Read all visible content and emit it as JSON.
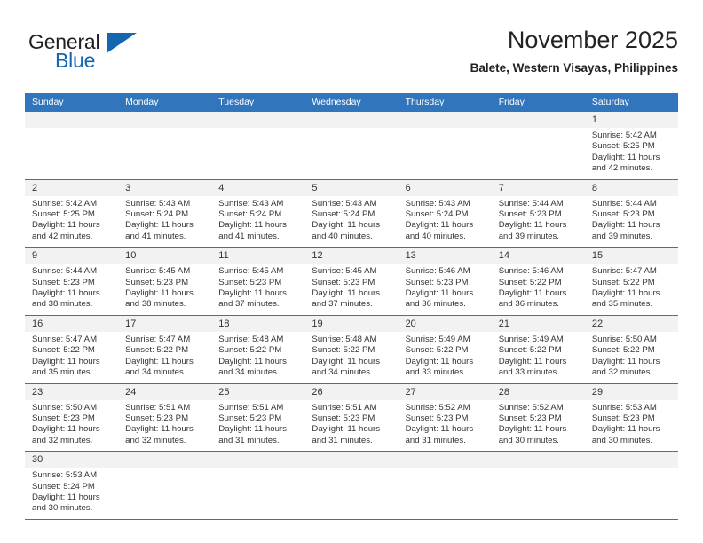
{
  "brand": {
    "name_part1": "General",
    "name_part2": "Blue",
    "triangle_color": "#1466b0"
  },
  "header": {
    "title": "November 2025",
    "subtitle": "Balete, Western Visayas, Philippines"
  },
  "theme": {
    "header_blue": "#3176bc",
    "row_divider": "#3176bc",
    "daynum_band": "#f2f2f2"
  },
  "calendar": {
    "weekday_headers": [
      "Sunday",
      "Monday",
      "Tuesday",
      "Wednesday",
      "Thursday",
      "Friday",
      "Saturday"
    ],
    "weeks": [
      [
        {
          "day": "",
          "lines": []
        },
        {
          "day": "",
          "lines": []
        },
        {
          "day": "",
          "lines": []
        },
        {
          "day": "",
          "lines": []
        },
        {
          "day": "",
          "lines": []
        },
        {
          "day": "",
          "lines": []
        },
        {
          "day": "1",
          "lines": [
            "Sunrise: 5:42 AM",
            "Sunset: 5:25 PM",
            "Daylight: 11 hours",
            "and 42 minutes."
          ]
        }
      ],
      [
        {
          "day": "2",
          "lines": [
            "Sunrise: 5:42 AM",
            "Sunset: 5:25 PM",
            "Daylight: 11 hours",
            "and 42 minutes."
          ]
        },
        {
          "day": "3",
          "lines": [
            "Sunrise: 5:43 AM",
            "Sunset: 5:24 PM",
            "Daylight: 11 hours",
            "and 41 minutes."
          ]
        },
        {
          "day": "4",
          "lines": [
            "Sunrise: 5:43 AM",
            "Sunset: 5:24 PM",
            "Daylight: 11 hours",
            "and 41 minutes."
          ]
        },
        {
          "day": "5",
          "lines": [
            "Sunrise: 5:43 AM",
            "Sunset: 5:24 PM",
            "Daylight: 11 hours",
            "and 40 minutes."
          ]
        },
        {
          "day": "6",
          "lines": [
            "Sunrise: 5:43 AM",
            "Sunset: 5:24 PM",
            "Daylight: 11 hours",
            "and 40 minutes."
          ]
        },
        {
          "day": "7",
          "lines": [
            "Sunrise: 5:44 AM",
            "Sunset: 5:23 PM",
            "Daylight: 11 hours",
            "and 39 minutes."
          ]
        },
        {
          "day": "8",
          "lines": [
            "Sunrise: 5:44 AM",
            "Sunset: 5:23 PM",
            "Daylight: 11 hours",
            "and 39 minutes."
          ]
        }
      ],
      [
        {
          "day": "9",
          "lines": [
            "Sunrise: 5:44 AM",
            "Sunset: 5:23 PM",
            "Daylight: 11 hours",
            "and 38 minutes."
          ]
        },
        {
          "day": "10",
          "lines": [
            "Sunrise: 5:45 AM",
            "Sunset: 5:23 PM",
            "Daylight: 11 hours",
            "and 38 minutes."
          ]
        },
        {
          "day": "11",
          "lines": [
            "Sunrise: 5:45 AM",
            "Sunset: 5:23 PM",
            "Daylight: 11 hours",
            "and 37 minutes."
          ]
        },
        {
          "day": "12",
          "lines": [
            "Sunrise: 5:45 AM",
            "Sunset: 5:23 PM",
            "Daylight: 11 hours",
            "and 37 minutes."
          ]
        },
        {
          "day": "13",
          "lines": [
            "Sunrise: 5:46 AM",
            "Sunset: 5:23 PM",
            "Daylight: 11 hours",
            "and 36 minutes."
          ]
        },
        {
          "day": "14",
          "lines": [
            "Sunrise: 5:46 AM",
            "Sunset: 5:22 PM",
            "Daylight: 11 hours",
            "and 36 minutes."
          ]
        },
        {
          "day": "15",
          "lines": [
            "Sunrise: 5:47 AM",
            "Sunset: 5:22 PM",
            "Daylight: 11 hours",
            "and 35 minutes."
          ]
        }
      ],
      [
        {
          "day": "16",
          "lines": [
            "Sunrise: 5:47 AM",
            "Sunset: 5:22 PM",
            "Daylight: 11 hours",
            "and 35 minutes."
          ]
        },
        {
          "day": "17",
          "lines": [
            "Sunrise: 5:47 AM",
            "Sunset: 5:22 PM",
            "Daylight: 11 hours",
            "and 34 minutes."
          ]
        },
        {
          "day": "18",
          "lines": [
            "Sunrise: 5:48 AM",
            "Sunset: 5:22 PM",
            "Daylight: 11 hours",
            "and 34 minutes."
          ]
        },
        {
          "day": "19",
          "lines": [
            "Sunrise: 5:48 AM",
            "Sunset: 5:22 PM",
            "Daylight: 11 hours",
            "and 34 minutes."
          ]
        },
        {
          "day": "20",
          "lines": [
            "Sunrise: 5:49 AM",
            "Sunset: 5:22 PM",
            "Daylight: 11 hours",
            "and 33 minutes."
          ]
        },
        {
          "day": "21",
          "lines": [
            "Sunrise: 5:49 AM",
            "Sunset: 5:22 PM",
            "Daylight: 11 hours",
            "and 33 minutes."
          ]
        },
        {
          "day": "22",
          "lines": [
            "Sunrise: 5:50 AM",
            "Sunset: 5:22 PM",
            "Daylight: 11 hours",
            "and 32 minutes."
          ]
        }
      ],
      [
        {
          "day": "23",
          "lines": [
            "Sunrise: 5:50 AM",
            "Sunset: 5:23 PM",
            "Daylight: 11 hours",
            "and 32 minutes."
          ]
        },
        {
          "day": "24",
          "lines": [
            "Sunrise: 5:51 AM",
            "Sunset: 5:23 PM",
            "Daylight: 11 hours",
            "and 32 minutes."
          ]
        },
        {
          "day": "25",
          "lines": [
            "Sunrise: 5:51 AM",
            "Sunset: 5:23 PM",
            "Daylight: 11 hours",
            "and 31 minutes."
          ]
        },
        {
          "day": "26",
          "lines": [
            "Sunrise: 5:51 AM",
            "Sunset: 5:23 PM",
            "Daylight: 11 hours",
            "and 31 minutes."
          ]
        },
        {
          "day": "27",
          "lines": [
            "Sunrise: 5:52 AM",
            "Sunset: 5:23 PM",
            "Daylight: 11 hours",
            "and 31 minutes."
          ]
        },
        {
          "day": "28",
          "lines": [
            "Sunrise: 5:52 AM",
            "Sunset: 5:23 PM",
            "Daylight: 11 hours",
            "and 30 minutes."
          ]
        },
        {
          "day": "29",
          "lines": [
            "Sunrise: 5:53 AM",
            "Sunset: 5:23 PM",
            "Daylight: 11 hours",
            "and 30 minutes."
          ]
        }
      ],
      [
        {
          "day": "30",
          "lines": [
            "Sunrise: 5:53 AM",
            "Sunset: 5:24 PM",
            "Daylight: 11 hours",
            "and 30 minutes."
          ]
        },
        {
          "day": "",
          "lines": []
        },
        {
          "day": "",
          "lines": []
        },
        {
          "day": "",
          "lines": []
        },
        {
          "day": "",
          "lines": []
        },
        {
          "day": "",
          "lines": []
        },
        {
          "day": "",
          "lines": []
        }
      ]
    ]
  }
}
